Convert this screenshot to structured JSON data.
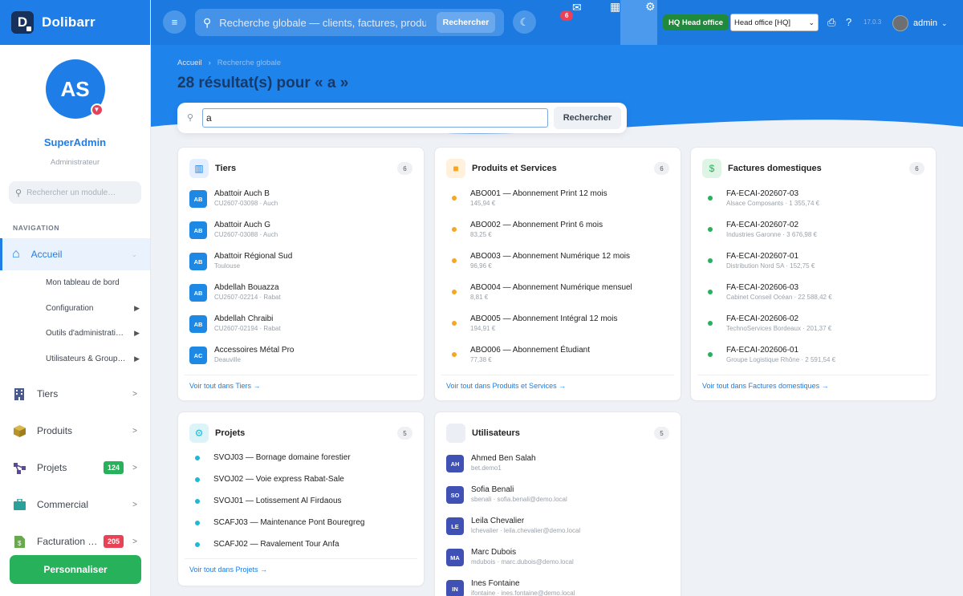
{
  "brand": {
    "name": "Dolibarr",
    "logo": "D"
  },
  "profile": {
    "initials": "AS",
    "name": "SuperAdmin",
    "role": "Administrateur"
  },
  "sidebar": {
    "search_placeholder": "Rechercher un module…",
    "nav_heading": "NAVIGATION",
    "active": "Accueil",
    "subitems": [
      "Mon tableau de bord",
      "Configuration",
      "Outils d'administrati…",
      "Utilisateurs & Group…"
    ],
    "items": [
      {
        "label": "Tiers",
        "icon": "building-icon",
        "badge": ""
      },
      {
        "label": "Produits",
        "icon": "box-icon",
        "badge": ""
      },
      {
        "label": "Projets",
        "icon": "project-icon",
        "badge": "124"
      },
      {
        "label": "Commercial",
        "icon": "briefcase-icon",
        "badge": ""
      },
      {
        "label": "Facturation …",
        "icon": "invoice-icon",
        "badge": "205"
      }
    ],
    "customize_label": "Personnaliser"
  },
  "topbar": {
    "search_placeholder": "Recherche globale — clients, factures, produits…",
    "search_button": "Rechercher",
    "notif_count": "6",
    "entity_badge": "HQ Head office",
    "entity_select": "Head office [HQ]",
    "version": "17.0.3",
    "user": "admin"
  },
  "page": {
    "breadcrumb": [
      "Accueil",
      "Recherche globale"
    ],
    "title": "28 résultat(s) pour « a »",
    "search_value": "a",
    "search_button": "Rechercher"
  },
  "colors": {
    "primary": "#1e7de6",
    "green": "#27b15a",
    "red": "#e94256",
    "orange": "#f5a623",
    "teal": "#1fb8d6",
    "indigo": "#3f51b5"
  },
  "cards": {
    "tiers": {
      "title": "Tiers",
      "count": "6",
      "link": "Voir tout dans Tiers →",
      "rows": [
        {
          "badge": "AB",
          "name": "Abattoir Auch B",
          "sub": "CU2607-03098 · Auch"
        },
        {
          "badge": "AB",
          "name": "Abattoir Auch G",
          "sub": "CU2607-03088 · Auch"
        },
        {
          "badge": "AB",
          "name": "Abattoir Régional Sud",
          "sub": "Toulouse"
        },
        {
          "badge": "AB",
          "name": "Abdellah Bouazza",
          "sub": "CU2607-02214 · Rabat"
        },
        {
          "badge": "AB",
          "name": "Abdellah Chraibi",
          "sub": "CU2607-02194 · Rabat"
        },
        {
          "badge": "AC",
          "name": "Accessoires Métal Pro",
          "sub": "Deauville"
        }
      ]
    },
    "produits": {
      "title": "Produits et Services",
      "count": "6",
      "link": "Voir tout dans Produits et Services →",
      "rows": [
        {
          "name": "ABO001 — Abonnement Print 12 mois",
          "sub": "145,94 €"
        },
        {
          "name": "ABO002 — Abonnement Print 6 mois",
          "sub": "83,25 €"
        },
        {
          "name": "ABO003 — Abonnement Numérique 12 mois",
          "sub": "96,96 €"
        },
        {
          "name": "ABO004 — Abonnement Numérique mensuel",
          "sub": "8,81 €"
        },
        {
          "name": "ABO005 — Abonnement Intégral 12 mois",
          "sub": "194,91 €"
        },
        {
          "name": "ABO006 — Abonnement Étudiant",
          "sub": "77,38 €"
        }
      ]
    },
    "factures": {
      "title": "Factures domestiques",
      "count": "6",
      "link": "Voir tout dans Factures domestiques →",
      "rows": [
        {
          "name": "FA-ECAI-202607-03",
          "sub": "Alsace Composants · 1 355,74 €"
        },
        {
          "name": "FA-ECAI-202607-02",
          "sub": "Industries Garonne · 3 676,98 €"
        },
        {
          "name": "FA-ECAI-202607-01",
          "sub": "Distribution Nord SA · 152,75 €"
        },
        {
          "name": "FA-ECAI-202606-03",
          "sub": "Cabinet Conseil Océan · 22 588,42 €"
        },
        {
          "name": "FA-ECAI-202606-02",
          "sub": "TechnoServices Bordeaux · 201,37 €"
        },
        {
          "name": "FA-ECAI-202606-01",
          "sub": "Groupe Logistique Rhône · 2 591,54 €"
        }
      ]
    },
    "projets": {
      "title": "Projets",
      "count": "5",
      "link": "Voir tout dans Projets →",
      "rows": [
        {
          "name": "SVOJ03 — Bornage domaine forestier"
        },
        {
          "name": "SVOJ02 — Voie express Rabat-Sale"
        },
        {
          "name": "SVOJ01 — Lotissement Al Firdaous"
        },
        {
          "name": "SCAFJ03 — Maintenance Pont Bouregreg"
        },
        {
          "name": "SCAFJ02 — Ravalement Tour Anfa"
        }
      ]
    },
    "utilisateurs": {
      "title": "Utilisateurs",
      "count": "5",
      "rows": [
        {
          "badge": "AH",
          "name": "Ahmed Ben Salah",
          "sub": "bet.demo1"
        },
        {
          "badge": "SO",
          "name": "Sofia Benali",
          "sub": "sbenali · sofia.benali@demo.local"
        },
        {
          "badge": "LE",
          "name": "Leila Chevalier",
          "sub": "lchevalier · leila.chevalier@demo.local"
        },
        {
          "badge": "MA",
          "name": "Marc Dubois",
          "sub": "mdubois · marc.dubois@demo.local"
        },
        {
          "badge": "IN",
          "name": "Ines Fontaine",
          "sub": "ifontaine · ines.fontaine@demo.local"
        }
      ]
    }
  }
}
